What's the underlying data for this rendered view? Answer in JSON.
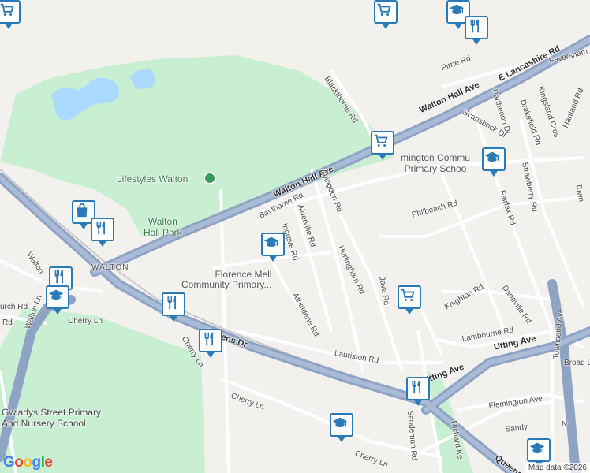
{
  "map": {
    "streets": [
      {
        "key": "walton_hall_ave",
        "name": "Walton Hall Ave"
      },
      {
        "key": "walton_hall_ave_2",
        "name": "Walton Hall Ave"
      },
      {
        "key": "e_lancashire",
        "name": "E Lancashire Rd"
      },
      {
        "key": "queens_dr",
        "name": "Queens Dr"
      },
      {
        "key": "queens_dr_2",
        "name": "Queens Dr"
      },
      {
        "key": "utting_ave",
        "name": "Utting Ave"
      },
      {
        "key": "utting_ave_2",
        "name": "Utting Ave"
      },
      {
        "key": "baythorne",
        "name": "Baythorne Rd"
      },
      {
        "key": "alderville",
        "name": "Alderville Rd"
      },
      {
        "key": "ingrave",
        "name": "Ingrave Rd"
      },
      {
        "key": "abingdon",
        "name": "Abingdon Rd"
      },
      {
        "key": "hurlingham",
        "name": "Hurlingham Rd"
      },
      {
        "key": "atheldene",
        "name": "Atheldene Rd"
      },
      {
        "key": "lauriston",
        "name": "Lauriston Rd"
      },
      {
        "key": "java",
        "name": "Java Rd"
      },
      {
        "key": "philbeach",
        "name": "Philbeach Rd"
      },
      {
        "key": "knighton",
        "name": "Knighton Rd"
      },
      {
        "key": "daneville",
        "name": "Daneville Rd"
      },
      {
        "key": "lambourne",
        "name": "Lambourne Rd"
      },
      {
        "key": "sandeman",
        "name": "Sandeman Rd"
      },
      {
        "key": "richard_ke",
        "name": "Richard Ke"
      },
      {
        "key": "flemington",
        "name": "Flemington Ave"
      },
      {
        "key": "sandy",
        "name": "Sandy"
      },
      {
        "key": "cherry_ln_1",
        "name": "Cherry Ln"
      },
      {
        "key": "cherry_ln_2",
        "name": "Cherry Ln"
      },
      {
        "key": "cherry_ln_3",
        "name": "Cherry Ln"
      },
      {
        "key": "cherry_ln_4",
        "name": "Cherry Ln"
      },
      {
        "key": "walton_ln",
        "name": "Walton Ln"
      },
      {
        "key": "blackthorne",
        "name": "Blackthorne Rd"
      },
      {
        "key": "pirrie",
        "name": "Pirrie Rd"
      },
      {
        "key": "parthenon",
        "name": "Parthenon Dr"
      },
      {
        "key": "scarisbrick",
        "name": "Scarisbrick Dr"
      },
      {
        "key": "drakefield",
        "name": "Drakefield Rd"
      },
      {
        "key": "strawberry",
        "name": "Strawberry Rd"
      },
      {
        "key": "fairfax",
        "name": "Fairfax Rd"
      },
      {
        "key": "hartland",
        "name": "Hartland Rd"
      },
      {
        "key": "townsend_ave",
        "name": "Townsend Ave"
      },
      {
        "key": "broad",
        "name": "Broad L"
      },
      {
        "key": "faversham",
        "name": "Faversham"
      },
      {
        "key": "kingsland",
        "name": "Kingsland Cres"
      },
      {
        "key": "church",
        "name": "urch Rd"
      },
      {
        "key": "rd_left",
        "name": "Rd"
      },
      {
        "key": "walton_left",
        "name": "Walton"
      },
      {
        "key": "n_rd",
        "name": "N"
      },
      {
        "key": "town",
        "name": "Town"
      }
    ],
    "places": {
      "walton_area": "WALTON",
      "park": "Walton\nHall Park",
      "lifestyles": "Lifestyles Walton",
      "florence": "Florence Mell\nCommunity Primary...",
      "lemington": "mington Commu\nPrimary Schoo",
      "gwladys": "Gwladys Street Primary\nAnd Nursery School"
    },
    "colors": {
      "background": "#f2f1ee",
      "park": "#c9efd2",
      "water": "#aadaff",
      "motorway": "#8fa4c4",
      "marker_border": "#2a7ab8"
    },
    "markers": [
      {
        "type": "shopping-cart",
        "name": "shopping-cart-marker-1"
      },
      {
        "type": "school",
        "name": "school-marker-1"
      },
      {
        "type": "restaurant",
        "name": "restaurant-marker-1"
      },
      {
        "type": "shopping-cart",
        "name": "shopping-cart-marker-2"
      },
      {
        "type": "school",
        "name": "school-marker-2"
      },
      {
        "type": "shopping-bag",
        "name": "shopping-bag-marker-1"
      },
      {
        "type": "restaurant",
        "name": "restaurant-marker-2"
      },
      {
        "type": "restaurant",
        "name": "restaurant-marker-3"
      },
      {
        "type": "school",
        "name": "school-marker-3"
      },
      {
        "type": "school",
        "name": "school-marker-4"
      },
      {
        "type": "restaurant",
        "name": "restaurant-marker-4"
      },
      {
        "type": "restaurant",
        "name": "restaurant-marker-5"
      },
      {
        "type": "shopping-cart",
        "name": "shopping-cart-marker-3"
      },
      {
        "type": "restaurant",
        "name": "restaurant-marker-6"
      },
      {
        "type": "school",
        "name": "school-marker-5"
      },
      {
        "type": "school",
        "name": "school-marker-6"
      },
      {
        "type": "shopping-cart",
        "name": "shopping-cart-marker-4"
      }
    ]
  },
  "footer": {
    "logo": "Google",
    "attribution": "Map data ©2026"
  }
}
